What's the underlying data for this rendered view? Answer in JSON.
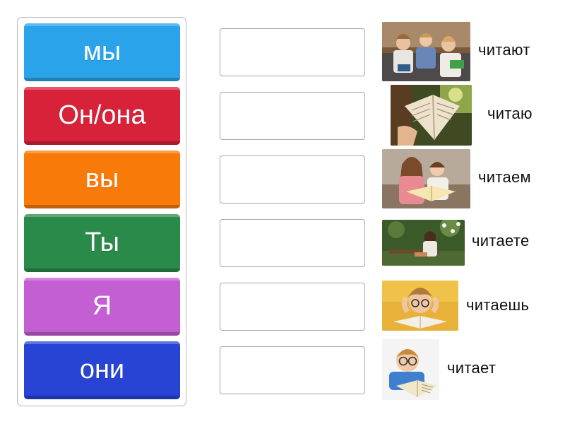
{
  "tiles": [
    {
      "label": "мы",
      "color": "#2aa3ea"
    },
    {
      "label": "Он/она",
      "color": "#d8223a"
    },
    {
      "label": "вы",
      "color": "#f87b0a"
    },
    {
      "label": "Ты",
      "color": "#2a8a4a"
    },
    {
      "label": "Я",
      "color": "#c35ed3"
    },
    {
      "label": "они",
      "color": "#2744d4"
    }
  ],
  "answers": [
    {
      "word": "читают",
      "image": "children-reading-on-couch"
    },
    {
      "word": "читаю",
      "image": "hand-holding-open-book"
    },
    {
      "word": "читаем",
      "image": "mother-and-daughter-reading"
    },
    {
      "word": "читаете",
      "image": "woman-reading-on-bench"
    },
    {
      "word": "читаешь",
      "image": "boy-frustrated-with-book"
    },
    {
      "word": "читает",
      "image": "boy-with-glasses-reading"
    }
  ]
}
